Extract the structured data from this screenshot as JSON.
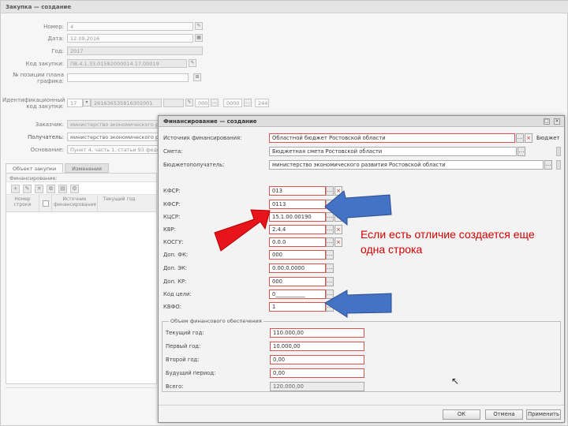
{
  "window": {
    "title": "Закупка — создание"
  },
  "bg_form": {
    "number_label": "Номер:",
    "number_value": "4",
    "date_label": "Дата:",
    "date_value": "12.09.2016",
    "year_label": "Год:",
    "year_value": "2017",
    "purchase_code_label": "Код закупки:",
    "purchase_code_value": "ПВ.4.1.33.01582000014.17.00019",
    "plan_pos_label": "№ позиции плана графика:",
    "ident_label": "Идентификационный код закупки:",
    "ident_seg1": "17",
    "ident_seg2": "261636535816301001",
    "ident_seg3": "000",
    "ident_seg4": "0000",
    "ident_seg5": "244",
    "customer_label": "Заказчик:",
    "customer_value": "министерство экономического р",
    "recipient_label": "Получатель:",
    "recipient_value": "министерство экономического р",
    "basis_label": "Основание:",
    "basis_value": "Пункт 4, часть 1, статьи 93 феде"
  },
  "tabs": [
    {
      "label": "Объект закупки"
    },
    {
      "label": "Изменения"
    }
  ],
  "grid": {
    "title": "Финансирование:",
    "headers": [
      "Номер строки",
      "",
      "Источник финансирования",
      "Текущий год"
    ]
  },
  "dialog": {
    "title": "Финансирование — создание",
    "source_label": "Источник финансирования:",
    "source_value": "Областной бюджет Ростовской области",
    "source_extra": "Бюджет",
    "estimate_label": "Смета:",
    "estimate_value": "Бюджетная смета Ростовской области",
    "budget_label": "Бюджетополучатель:",
    "budget_value": "министерство экономического развития Ростовской области",
    "kvr_label": "КФСР:",
    "kvr_value": "013",
    "kfsr_label": "КФСР:",
    "kfsr_value": "0113",
    "kcsr_label": "КЦСР:",
    "kcsr_value": "15.1.00.00190",
    "kvr2_label": "КВР:",
    "kvr2_value": "2.4.4",
    "kosgu_label": "КОСГУ:",
    "kosgu_value": "0.0.0",
    "dopfk_label": "Доп. ФК:",
    "dopfk_value": "000",
    "dopek_label": "Доп. ЭК:",
    "dopek_value": "0.00.0.0000",
    "dopkr_label": "Доп. КР:",
    "dopkr_value": "000",
    "goal_label": "Код цели:",
    "goal_value": "0___________",
    "kvfo_label": "КВФО:",
    "kvfo_value": "1",
    "fieldset_legend": "Объем финансового обеспечения",
    "current_year_label": "Текущий год:",
    "current_year_value": "110.000,00",
    "first_year_label": "Первый год:",
    "first_year_value": "10.000,00",
    "second_year_label": "Второй год:",
    "second_year_value": "0,00",
    "future_label": "Будущий период:",
    "future_value": "0,00",
    "total_label": "Всего:",
    "total_value": "120.000,00",
    "ok_label": "ОК",
    "cancel_label": "Отмена",
    "apply_label": "Применить"
  },
  "annotation": {
    "text": "Если есть отличие создается еще одна строка"
  },
  "colors": {
    "red_arrow": "#e8141c",
    "blue_arrow": "#4472c4",
    "annotation_text": "#d40000"
  }
}
